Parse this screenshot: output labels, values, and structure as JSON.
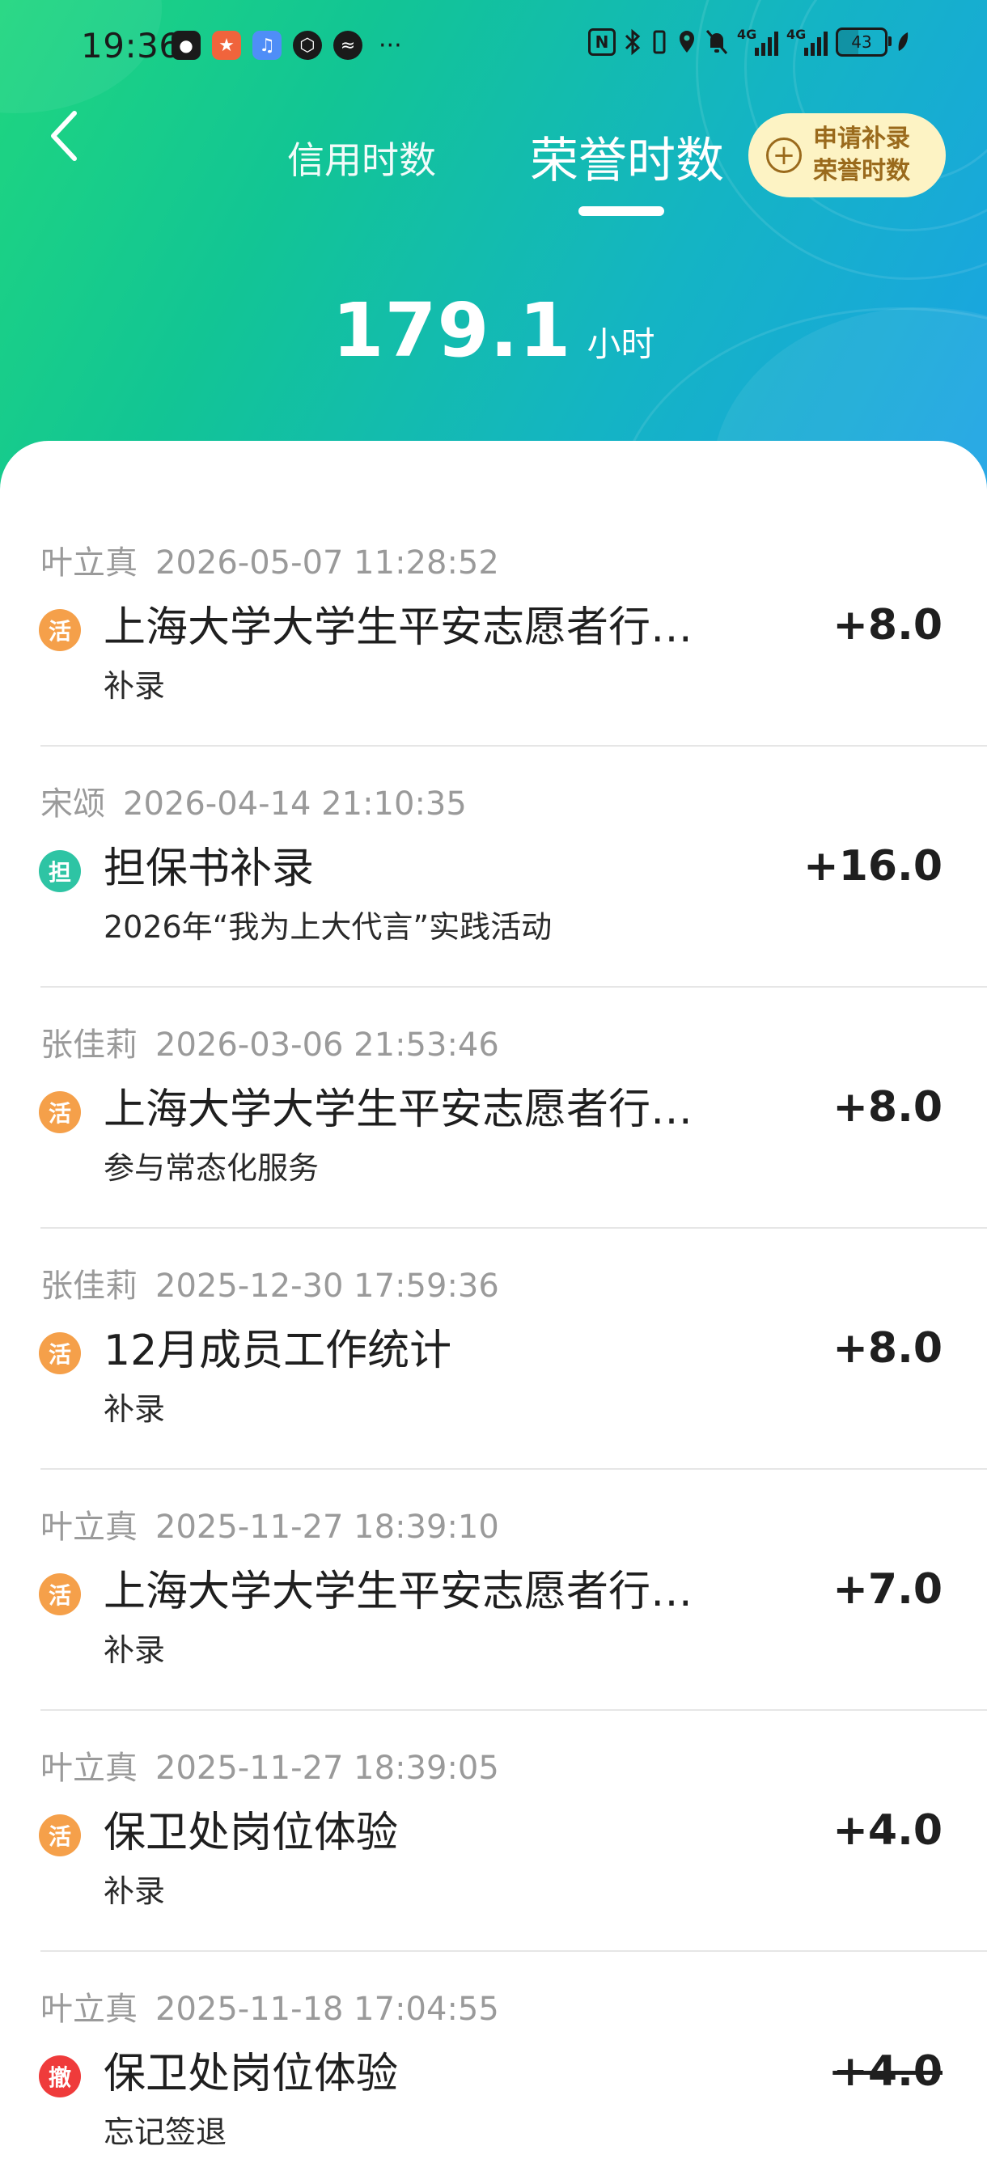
{
  "status_bar": {
    "time": "19:36",
    "more": "···",
    "network_gen_1": "4G",
    "network_gen_2": "4G",
    "battery": "43"
  },
  "nav": {
    "tabs": [
      {
        "label": "信用时数",
        "active": false
      },
      {
        "label": "荣誉时数",
        "active": true
      }
    ],
    "apply_button": {
      "line1": "申请补录",
      "line2": "荣誉时数"
    }
  },
  "summary": {
    "value": "179.1",
    "unit": "小时"
  },
  "records": [
    {
      "name": "叶立真",
      "datetime": "2026-05-07 11:28:52",
      "badge": "活",
      "badge_color": "#f5a04a",
      "title": "上海大学大学生平安志愿者行…",
      "subtitle": "补录",
      "amount": "+8.0",
      "revoked": false
    },
    {
      "name": "宋颂",
      "datetime": "2026-04-14 21:10:35",
      "badge": "担",
      "badge_color": "#2ec4a4",
      "title": "担保书补录",
      "subtitle": "2026年“我为上大代言”实践活动",
      "amount": "+16.0",
      "revoked": false
    },
    {
      "name": "张佳莉",
      "datetime": "2026-03-06 21:53:46",
      "badge": "活",
      "badge_color": "#f5a04a",
      "title": "上海大学大学生平安志愿者行…",
      "subtitle": "参与常态化服务",
      "amount": "+8.0",
      "revoked": false
    },
    {
      "name": "张佳莉",
      "datetime": "2025-12-30 17:59:36",
      "badge": "活",
      "badge_color": "#f5a04a",
      "title": "12月成员工作统计",
      "subtitle": "补录",
      "amount": "+8.0",
      "revoked": false
    },
    {
      "name": "叶立真",
      "datetime": "2025-11-27 18:39:10",
      "badge": "活",
      "badge_color": "#f5a04a",
      "title": "上海大学大学生平安志愿者行…",
      "subtitle": "补录",
      "amount": "+7.0",
      "revoked": false
    },
    {
      "name": "叶立真",
      "datetime": "2025-11-27 18:39:05",
      "badge": "活",
      "badge_color": "#f5a04a",
      "title": "保卫处岗位体验",
      "subtitle": "补录",
      "amount": "+4.0",
      "revoked": false
    },
    {
      "name": "叶立真",
      "datetime": "2025-11-18 17:04:55",
      "badge": "撤",
      "badge_color": "#ef3b3b",
      "title": "保卫处岗位体验",
      "subtitle": "忘记签退",
      "amount": "+4.0",
      "revoked": true
    }
  ]
}
